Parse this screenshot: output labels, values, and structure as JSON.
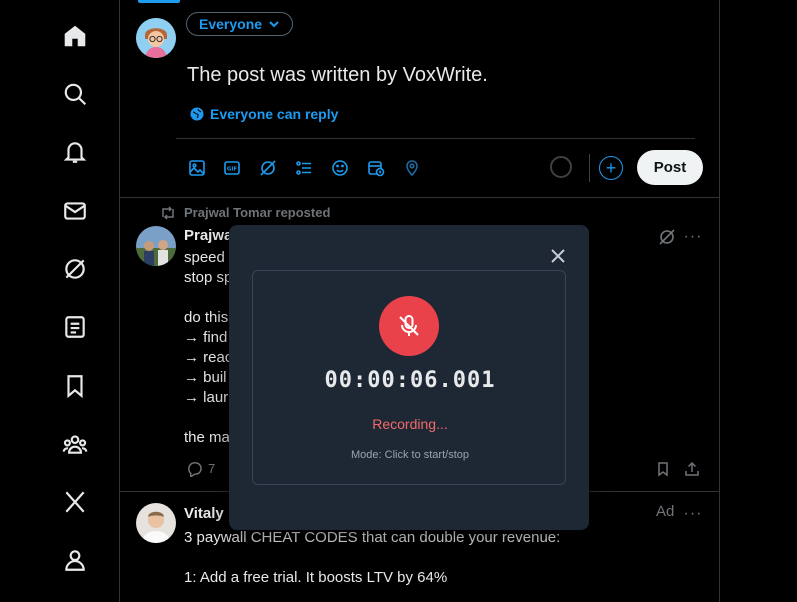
{
  "nav": {
    "icons": [
      "home-icon",
      "search-icon",
      "notifications-icon",
      "messages-icon",
      "grok-icon",
      "lists-icon",
      "bookmarks-icon",
      "communities-icon",
      "x-premium-icon",
      "profile-icon"
    ]
  },
  "composer": {
    "audience_label": "Everyone",
    "text": "The post was written by VoxWrite.",
    "reply_setting": "Everyone can reply",
    "tools": [
      "image-icon",
      "gif-icon",
      "grok-icon",
      "poll-icon",
      "emoji-icon",
      "schedule-icon",
      "location-icon"
    ],
    "post_label": "Post",
    "add_label": "+"
  },
  "tweets": [
    {
      "repost_label": "Prajwal Tomar reposted",
      "name": "Prajwa",
      "lines": [
        "speed",
        "stop sp",
        "",
        "do this",
        "→ find",
        "→ reac",
        "→ buil",
        "→ laur",
        "",
        "the ma"
      ],
      "reply_count": "7"
    },
    {
      "name": "Vitaly",
      "ad_label": "Ad",
      "lines": [
        "3 paywall CHEAT CODES that can double your revenue:",
        "",
        "1: Add a free trial. It boosts LTV by 64%"
      ]
    }
  ],
  "recorder": {
    "timer": "00:00:06.001",
    "status": "Recording...",
    "mode": "Mode: Click to start/stop"
  },
  "colors": {
    "accent": "#1d9bf0",
    "record": "#e9424a",
    "modal_bg": "#1e2734"
  }
}
